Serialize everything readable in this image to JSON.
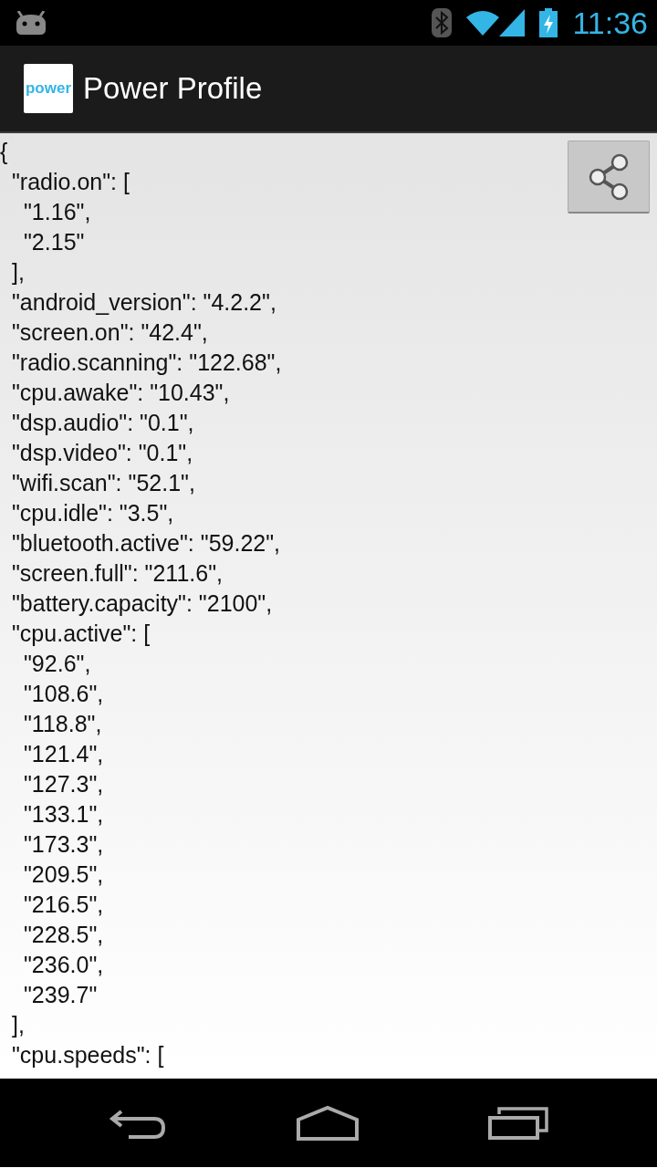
{
  "status_bar": {
    "time": "11:36"
  },
  "action_bar": {
    "app_icon_text": "power",
    "title": "Power Profile"
  },
  "document": [
    {
      "text": "{",
      "children": [
        {
          "text": "\"radio.on\": [",
          "children": [
            {
              "text": "\"1.16\","
            },
            {
              "text": "\"2.15\""
            }
          ]
        },
        {
          "text": "],"
        },
        {
          "text": "\"android_version\": \"4.2.2\","
        },
        {
          "text": "\"screen.on\": \"42.4\","
        },
        {
          "text": "\"radio.scanning\": \"122.68\","
        },
        {
          "text": "\"cpu.awake\": \"10.43\","
        },
        {
          "text": "\"dsp.audio\": \"0.1\","
        },
        {
          "text": "\"dsp.video\": \"0.1\","
        },
        {
          "text": "\"wifi.scan\": \"52.1\","
        },
        {
          "text": "\"cpu.idle\": \"3.5\","
        },
        {
          "text": "\"bluetooth.active\": \"59.22\","
        },
        {
          "text": "\"screen.full\": \"211.6\","
        },
        {
          "text": "\"battery.capacity\": \"2100\","
        },
        {
          "text": "\"cpu.active\": [",
          "children": [
            {
              "text": "\"92.6\","
            },
            {
              "text": "\"108.6\","
            },
            {
              "text": "\"118.8\","
            },
            {
              "text": "\"121.4\","
            },
            {
              "text": "\"127.3\","
            },
            {
              "text": "\"133.1\","
            },
            {
              "text": "\"173.3\","
            },
            {
              "text": "\"209.5\","
            },
            {
              "text": "\"216.5\","
            },
            {
              "text": "\"228.5\","
            },
            {
              "text": "\"236.0\","
            },
            {
              "text": "\"239.7\""
            }
          ]
        },
        {
          "text": "],"
        },
        {
          "text": "\"cpu.speeds\": ["
        }
      ]
    }
  ]
}
